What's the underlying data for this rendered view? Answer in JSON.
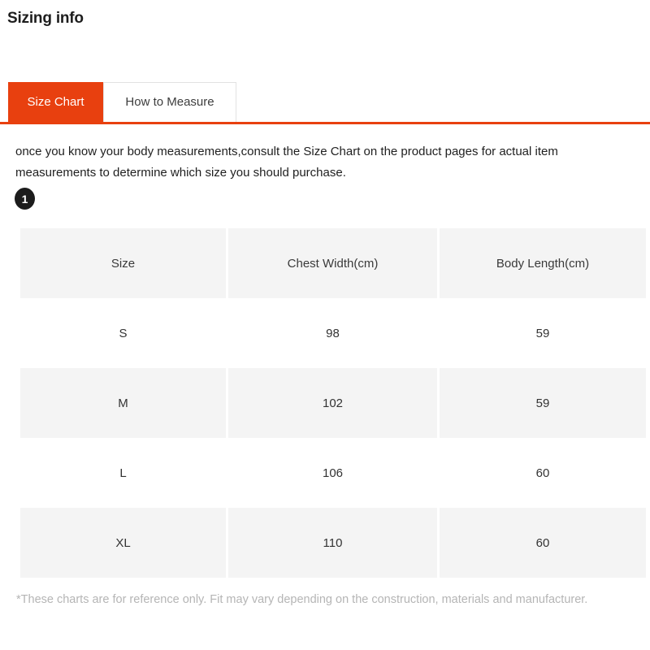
{
  "header": {
    "title": "Sizing info"
  },
  "tabs": {
    "items": [
      {
        "label": "Size Chart",
        "active": true
      },
      {
        "label": "How to Measure",
        "active": false
      }
    ],
    "active_color": "#e8400f",
    "underline_color": "#e8400f"
  },
  "intro": {
    "text": "once you know your body measurements,consult the Size Chart on the product pages for actual item measurements to determine which size you should purchase."
  },
  "step_badge": {
    "number": "1"
  },
  "chart_data": {
    "type": "table",
    "title": "Size Chart",
    "columns": [
      "Size",
      "Chest Width(cm)",
      "Body Length(cm)"
    ],
    "rows": [
      [
        "S",
        "98",
        "59"
      ],
      [
        "M",
        "102",
        "59"
      ],
      [
        "L",
        "106",
        "60"
      ],
      [
        "XL",
        "110",
        "60"
      ]
    ],
    "series": [
      {
        "name": "Chest Width(cm)",
        "values": [
          98,
          102,
          106,
          110
        ]
      },
      {
        "name": "Body Length(cm)",
        "values": [
          59,
          59,
          60,
          60
        ]
      }
    ],
    "categories": [
      "S",
      "M",
      "L",
      "XL"
    ],
    "header_background": "#f4f4f4",
    "stripe_background": "#f4f4f4"
  },
  "footnote": {
    "text": "*These charts are for reference only. Fit may vary depending on the construction, materials and manufacturer."
  }
}
